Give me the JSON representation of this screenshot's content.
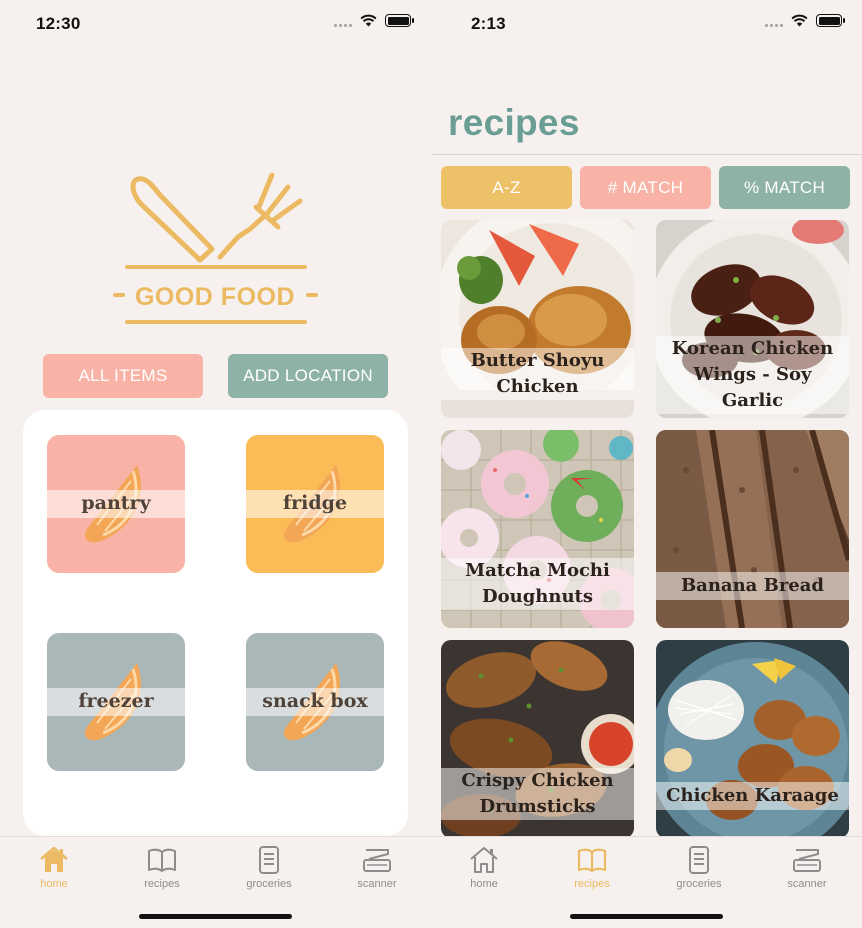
{
  "left_screen": {
    "status": {
      "time": "12:30"
    },
    "logo": {
      "text": "GOOD FOOD"
    },
    "buttons": {
      "all_items": "ALL ITEMS",
      "add_location": "ADD LOCATION"
    },
    "locations": [
      {
        "label": "pantry",
        "color": "#f8b3a6"
      },
      {
        "label": "fridge",
        "color": "#fbbc58"
      },
      {
        "label": "freezer",
        "color": "#a9b7b8"
      },
      {
        "label": "snack box",
        "color": "#a9b7b8"
      }
    ],
    "tabs": [
      {
        "label": "home",
        "icon": "home-icon",
        "active": true
      },
      {
        "label": "recipes",
        "icon": "book-icon",
        "active": false
      },
      {
        "label": "groceries",
        "icon": "list-icon",
        "active": false
      },
      {
        "label": "scanner",
        "icon": "scanner-icon",
        "active": false
      }
    ]
  },
  "right_screen": {
    "status": {
      "time": "2:13"
    },
    "title": "recipes",
    "sort": {
      "az": "A-Z",
      "count_match": "# MATCH",
      "percent_match": "% MATCH"
    },
    "recipes": [
      {
        "name": "Butter Shoyu Chicken"
      },
      {
        "name": "Korean Chicken Wings - Soy Garlic"
      },
      {
        "name": "Matcha Mochi Doughnuts"
      },
      {
        "name": "Banana Bread"
      },
      {
        "name": "Crispy Chicken Drumsticks"
      },
      {
        "name": "Chicken Karaage"
      }
    ],
    "tabs": [
      {
        "label": "home",
        "icon": "home-icon",
        "active": false
      },
      {
        "label": "recipes",
        "icon": "book-icon",
        "active": true
      },
      {
        "label": "groceries",
        "icon": "list-icon",
        "active": false
      },
      {
        "label": "scanner",
        "icon": "scanner-icon",
        "active": false
      }
    ]
  },
  "colors": {
    "accent_yellow": "#ebba62",
    "accent_pink": "#f8b3a6",
    "accent_teal": "#8fb2a8",
    "title_teal": "#6a9e95",
    "background": "#f6f1ee"
  }
}
